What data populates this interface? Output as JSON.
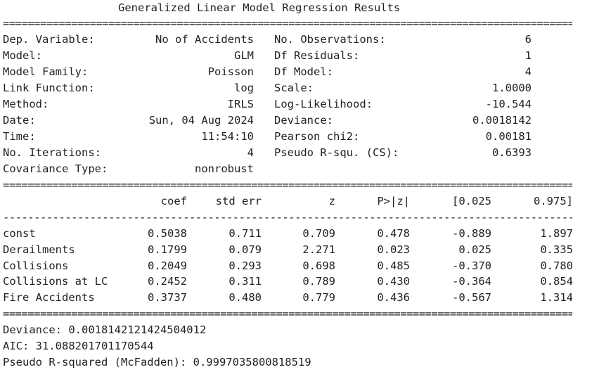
{
  "title": "Generalized Linear Model Regression Results",
  "rules": {
    "double": "===================================================================================================",
    "dashed": "---------------------------------------------------------------------------------------------------"
  },
  "summary_left": [
    {
      "label": "Dep. Variable:",
      "value": "No of Accidents"
    },
    {
      "label": "Model:",
      "value": "GLM"
    },
    {
      "label": "Model Family:",
      "value": "Poisson"
    },
    {
      "label": "Link Function:",
      "value": "log"
    },
    {
      "label": "Method:",
      "value": "IRLS"
    },
    {
      "label": "Date:",
      "value": "Sun, 04 Aug 2024"
    },
    {
      "label": "Time:",
      "value": "11:54:10"
    },
    {
      "label": "No. Iterations:",
      "value": "4"
    },
    {
      "label": "Covariance Type:",
      "value": "nonrobust"
    }
  ],
  "summary_right": [
    {
      "label": "No. Observations:",
      "value": "6"
    },
    {
      "label": "Df Residuals:",
      "value": "1"
    },
    {
      "label": "Df Model:",
      "value": "4"
    },
    {
      "label": "Scale:",
      "value": "1.0000"
    },
    {
      "label": "Log-Likelihood:",
      "value": "-10.544"
    },
    {
      "label": "Deviance:",
      "value": "0.0018142"
    },
    {
      "label": "Pearson chi2:",
      "value": "0.00181"
    },
    {
      "label": "Pseudo R-squ. (CS):",
      "value": "0.6393"
    }
  ],
  "coef_table": {
    "headers": [
      "coef",
      "std err",
      "z",
      "P>|z|",
      "[0.025",
      "0.975]"
    ],
    "rows": [
      {
        "name": "const",
        "values": [
          "0.5038",
          "0.711",
          "0.709",
          "0.478",
          "-0.889",
          "1.897"
        ]
      },
      {
        "name": "Derailments",
        "values": [
          "0.1799",
          "0.079",
          "2.271",
          "0.023",
          "0.025",
          "0.335"
        ]
      },
      {
        "name": "Collisions",
        "values": [
          "0.2049",
          "0.293",
          "0.698",
          "0.485",
          "-0.370",
          "0.780"
        ]
      },
      {
        "name": "Collisions at LC",
        "values": [
          "0.2452",
          "0.311",
          "0.789",
          "0.430",
          "-0.364",
          "0.854"
        ]
      },
      {
        "name": "Fire Accidents",
        "values": [
          "0.3737",
          "0.480",
          "0.779",
          "0.436",
          "-0.567",
          "1.314"
        ]
      }
    ]
  },
  "footer": {
    "deviance": "Deviance: 0.0018142121424504012",
    "aic": "AIC: 31.088201701170544",
    "pseudo_r2": "Pseudo R-squared (McFadden): 0.9997035800818519"
  }
}
